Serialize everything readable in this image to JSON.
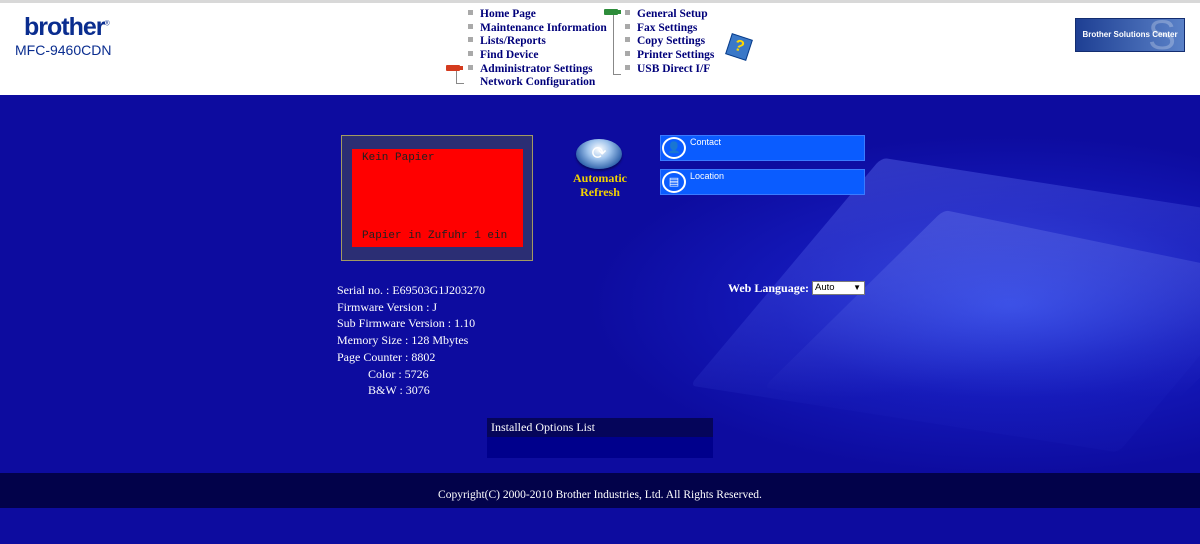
{
  "brand": {
    "logo_text": "brother",
    "logo_mark": "®",
    "model": "MFC-9460CDN"
  },
  "nav": {
    "left": [
      "Home Page",
      "Maintenance Information",
      "Lists/Reports",
      "Find Device",
      "Administrator Settings",
      "Network Configuration"
    ],
    "right": [
      "General Setup",
      "Fax Settings",
      "Copy Settings",
      "Printer Settings",
      "USB Direct I/F"
    ]
  },
  "help": {
    "icon": "help-icon",
    "glyph": "?"
  },
  "solutions_center": {
    "label": "Brother Solutions Center"
  },
  "status": {
    "line1": "Kein Papier",
    "line2": "Papier in Zufuhr 1 ein",
    "color": "#ff0000"
  },
  "refresh": {
    "label_line1": "Automatic",
    "label_line2": "Refresh"
  },
  "links": {
    "contact": "Contact",
    "location": "Location"
  },
  "device_info": {
    "serial": "Serial no. : E69503G1J203270",
    "firmware": "Firmware Version : J",
    "sub_firmware": "Sub Firmware Version : 1.10",
    "memory": "Memory Size : 128 Mbytes",
    "page_counter": "Page Counter : 8802",
    "color": "Color : 5726",
    "bw": "B&W : 3076"
  },
  "web_language": {
    "label": "Web Language:",
    "selected": "Auto"
  },
  "installed_options": {
    "title": "Installed Options List"
  },
  "footer": {
    "copyright": "Copyright(C) 2000-2010 Brother Industries, Ltd. All Rights Reserved."
  },
  "colors": {
    "main_bg": "#0d0c9f",
    "footer_bg": "#02024a",
    "accent_button": "#0a5cff",
    "refresh_text": "#f2d200"
  }
}
